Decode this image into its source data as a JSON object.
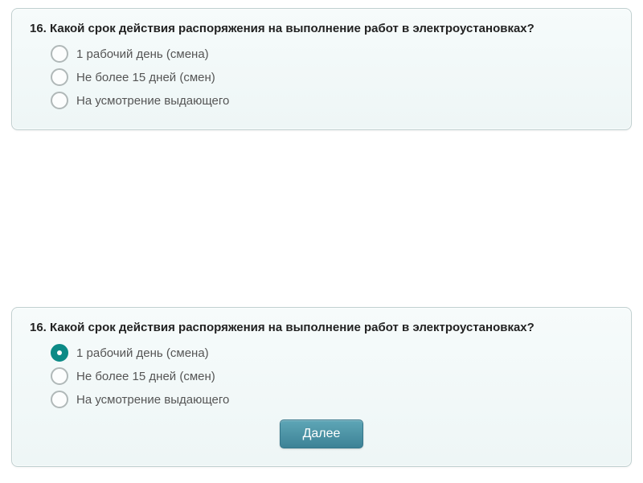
{
  "card1": {
    "question": "16. Какой срок действия распоряжения на выполнение работ в электроустановках?",
    "options": [
      {
        "label": "1 рабочий день (смена)",
        "selected": false
      },
      {
        "label": "Не более 15 дней (смен)",
        "selected": false
      },
      {
        "label": "На усмотрение выдающего",
        "selected": false
      }
    ]
  },
  "card2": {
    "question": "16. Какой срок действия распоряжения на выполнение работ в электроустановках?",
    "options": [
      {
        "label": "1 рабочий день (смена)",
        "selected": true
      },
      {
        "label": "Не более 15 дней (смен)",
        "selected": false
      },
      {
        "label": "На усмотрение выдающего",
        "selected": false
      }
    ],
    "next_label": "Далее"
  }
}
